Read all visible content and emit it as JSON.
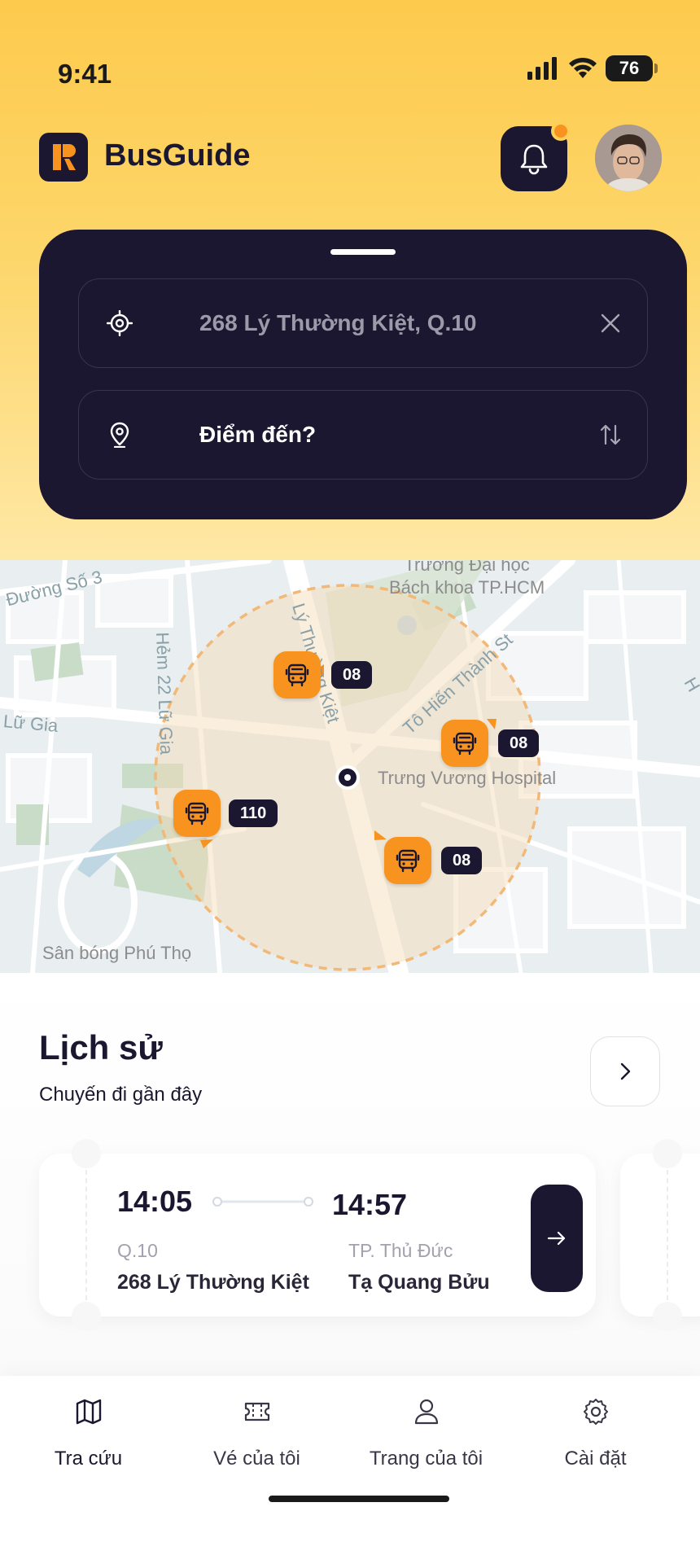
{
  "status_bar": {
    "time": "9:41",
    "battery": "76"
  },
  "header": {
    "app_title": "BusGuide",
    "brand_color": "#1b1730",
    "accent_color": "#f7931e",
    "icons": [
      "bus-logo-icon",
      "bell-icon",
      "avatar"
    ]
  },
  "search": {
    "origin_value": "268 Lý Thường Kiệt, Q.10",
    "destination_placeholder": "Điểm đến?",
    "icons": [
      "crosshair-icon",
      "clear-icon",
      "map-pin-icon",
      "swap-icon"
    ]
  },
  "map": {
    "labels": {
      "university": "Trường Đại học\nBách khoa TP.HCM",
      "street_so3": "Đường Số 3",
      "hem22": "Hẻm 22 Lữ Gia",
      "ly_thuong_kiet": "Lý Thường Kiệt",
      "to_hien_thanh": "Tô Hiến Thành St",
      "lu_gia": "Lữ Gia",
      "hospital": "Trưng Vương Hospital",
      "stadium": "Sân bóng Phú Thọ",
      "edge_h": "H"
    },
    "buses": [
      {
        "route": "08"
      },
      {
        "route": "08"
      },
      {
        "route": "110"
      },
      {
        "route": "08"
      }
    ]
  },
  "history": {
    "title": "Lịch sử",
    "subtitle": "Chuyến đi gần đây",
    "trip": {
      "depart_time": "14:05",
      "arrive_time": "14:57",
      "from_district": "Q.10",
      "from_street": "268 Lý Thường Kiệt",
      "to_district": "TP. Thủ Đức",
      "to_street": "Tạ Quang Bửu"
    }
  },
  "nav": {
    "items": [
      {
        "label": "Tra cứu",
        "icon": "map-icon"
      },
      {
        "label": "Vé của tôi",
        "icon": "ticket-icon"
      },
      {
        "label": "Trang của tôi",
        "icon": "user-icon"
      },
      {
        "label": "Cài đặt",
        "icon": "gear-icon"
      }
    ]
  }
}
